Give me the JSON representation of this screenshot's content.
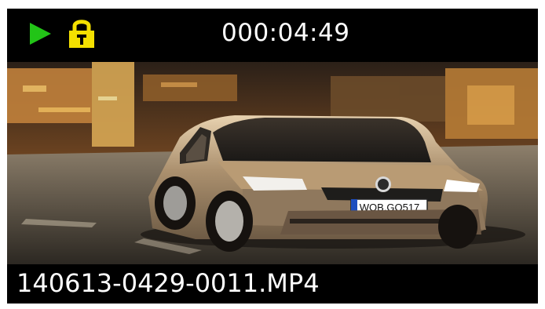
{
  "status_bar": {
    "play_state_icon": "play-icon",
    "lock_icon": "lock-icon",
    "elapsed_time": "000:04:49"
  },
  "video": {
    "subject": "car-photo",
    "plate_text": "WOB.GO517"
  },
  "file_bar": {
    "filename": "140613-0429-0011.MP4"
  },
  "colors": {
    "background": "#000000",
    "play_icon": "#22c417",
    "lock_icon": "#f4e000",
    "text": "#ffffff"
  }
}
